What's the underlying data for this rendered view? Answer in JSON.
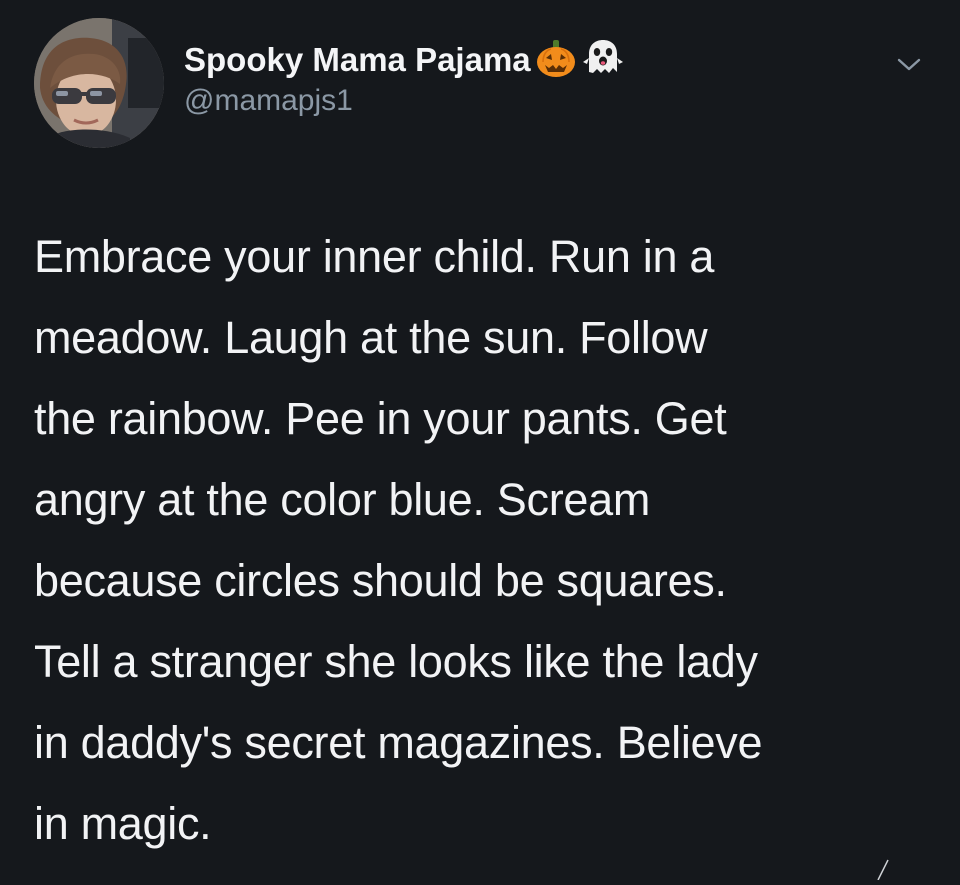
{
  "tweet": {
    "display_name": "Spooky Mama Pajama",
    "name_emojis": [
      "jack-o-lantern-icon",
      "ghost-icon"
    ],
    "handle": "@mamapjs1",
    "text_lines": [
      "Embrace your inner child. Run in a",
      "meadow. Laugh at the sun. Follow",
      "the rainbow. Pee in your pants. Get",
      "angry at the color blue. Scream",
      "because circles should be squares.",
      "Tell a stranger she looks like the lady",
      "in daddy's secret magazines. Believe",
      "in magic."
    ]
  },
  "colors": {
    "background": "#15181c",
    "primary_text": "#f2f3f5",
    "secondary_text": "#8b98a5",
    "pumpkin": "#f28c1b",
    "ghost": "#f0f0f0"
  },
  "icons": {
    "menu": "chevron-down-icon"
  }
}
